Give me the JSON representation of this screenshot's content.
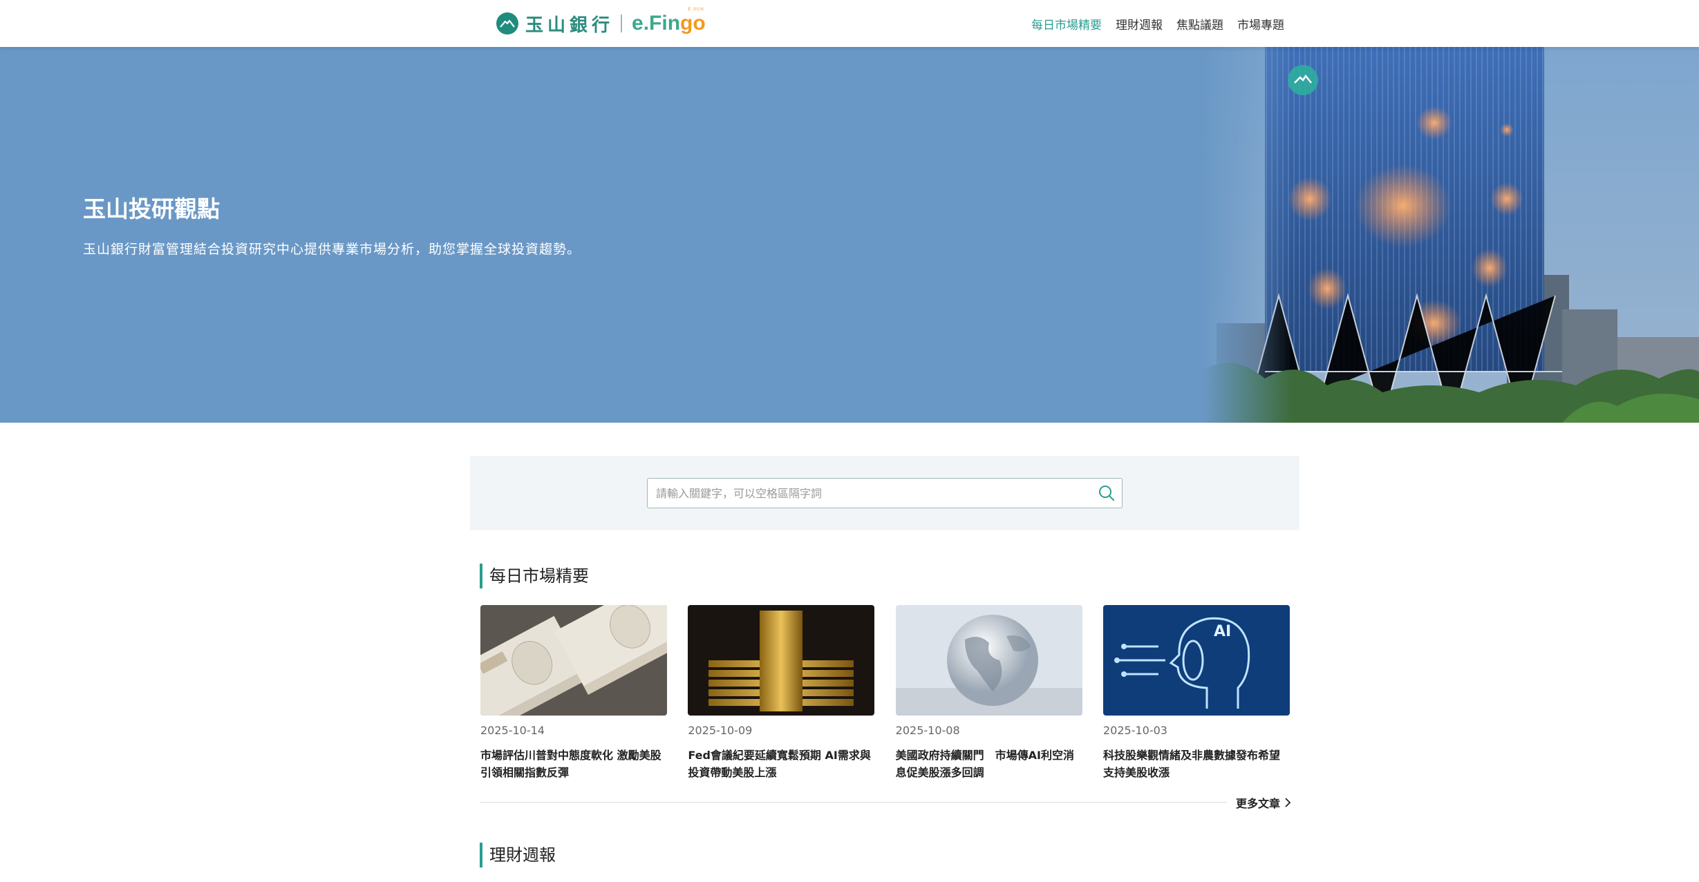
{
  "header": {
    "brand_name": "玉山銀行",
    "brand_sub": "e.Fingo",
    "nav": [
      {
        "label": "每日市場精要",
        "active": true
      },
      {
        "label": "理財週報",
        "active": false
      },
      {
        "label": "焦點議題",
        "active": false
      },
      {
        "label": "市場專題",
        "active": false
      }
    ]
  },
  "hero": {
    "title": "玉山投研觀點",
    "description": "玉山銀行財富管理結合投資研究中心提供專業市場分析，助您掌握全球投資趨勢。"
  },
  "search": {
    "placeholder": "請輸入關鍵字，可以空格區隔字詞",
    "value": ""
  },
  "daily": {
    "title": "每日市場精要",
    "articles": [
      {
        "date": "2025-10-14",
        "title": "市場評估川普對中態度軟化 激勵美股引領相關指數反彈",
        "image": "yen-banknotes"
      },
      {
        "date": "2025-10-09",
        "title": "Fed會議紀要延續寬鬆預期 AI需求與投資帶動美股上漲",
        "image": "gold-bars"
      },
      {
        "date": "2025-10-08",
        "title": "美國政府持續關門　市場傳AI利空消息促美股漲多回調",
        "image": "glass-globe"
      },
      {
        "date": "2025-10-03",
        "title": "科技股樂觀情緒及非農數據發布希望支持美股收漲",
        "image": "ai-head"
      }
    ],
    "more_label": "更多文章"
  },
  "weekly": {
    "title": "理財週報"
  },
  "colors": {
    "accent": "#2a9d8f",
    "hero_bg": "#6a98c6"
  }
}
